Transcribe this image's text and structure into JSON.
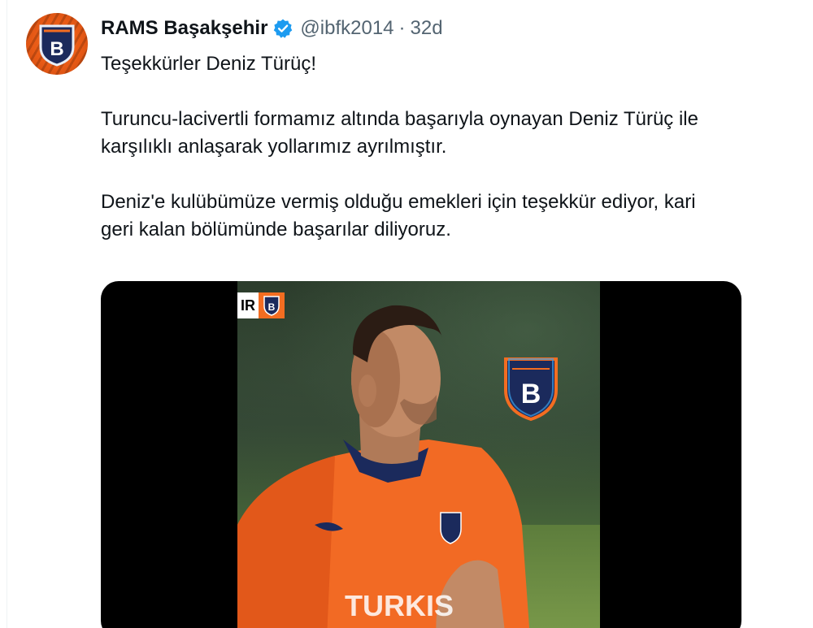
{
  "tweet": {
    "display_name": "RAMS Başakşehir",
    "handle": "@ibfk2014",
    "separator": "·",
    "time": "32d",
    "verified": true,
    "avatar_icon": "club-crest-icon",
    "text_lines": [
      "Teşekkürler Deniz Türüç!",
      "",
      "Turuncu-lacivertli formamız altında başarıyla oynayan Deniz Türüç ile",
      "karşılıklı anlaşarak yollarımız ayrılmıştır.",
      "",
      "Deniz'e kulübümüze vermiş olduğu emekleri için teşekkür ediyor, kari",
      "geri kalan bölümünde başarılar diliyoruz."
    ]
  },
  "media": {
    "type": "video",
    "score_badge_text": "IR",
    "jersey_text": "TURKIS",
    "colors": {
      "brand_orange": "#f36d21",
      "brand_navy": "#1b2a5c",
      "text_primary": "#0f1419",
      "text_secondary": "#536471",
      "verified_blue": "#1d9bf0"
    }
  }
}
